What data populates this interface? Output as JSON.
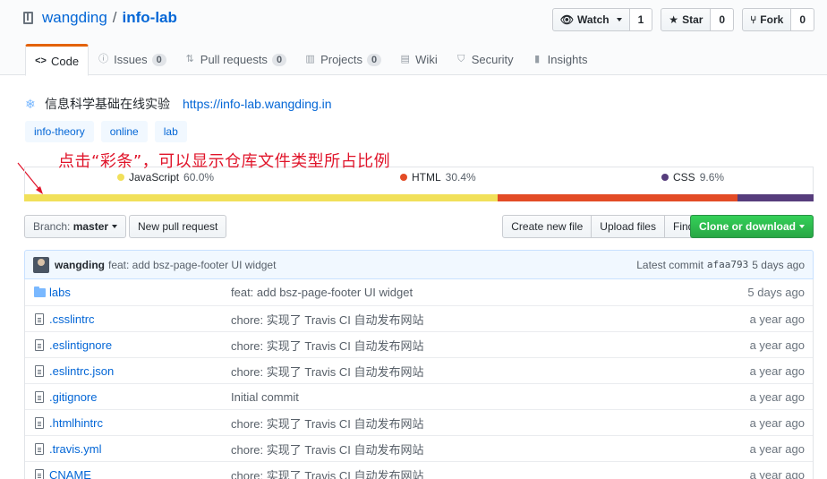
{
  "repo": {
    "owner": "wangding",
    "separator": "/",
    "name": "info-lab"
  },
  "actions": [
    {
      "label": "Watch",
      "icon": "eye-icon",
      "count": "1"
    },
    {
      "label": "Star",
      "icon": "star-icon",
      "count": "0"
    },
    {
      "label": "Fork",
      "icon": "fork-icon",
      "count": "0"
    }
  ],
  "tabs": [
    {
      "label": "Code",
      "icon": "code-icon",
      "selected": true
    },
    {
      "label": "Issues",
      "icon": "issue-icon",
      "count": "0"
    },
    {
      "label": "Pull requests",
      "icon": "pull-request-icon",
      "count": "0"
    },
    {
      "label": "Projects",
      "icon": "project-icon",
      "count": "0"
    },
    {
      "label": "Wiki",
      "icon": "book-icon"
    },
    {
      "label": "Security",
      "icon": "shield-icon"
    },
    {
      "label": "Insights",
      "icon": "graph-icon"
    }
  ],
  "description": {
    "text": "信息科学基础在线实验",
    "url": "https://info-lab.wangding.in"
  },
  "topics": [
    "info-theory",
    "online",
    "lab"
  ],
  "annotation": "点击“彩条”，可以显示仓库文件类型所占比例",
  "languages": [
    {
      "name": "JavaScript",
      "percent": "60.0%",
      "value": 60.0,
      "color": "#f1e05a"
    },
    {
      "name": "HTML",
      "percent": "30.4%",
      "value": 30.4,
      "color": "#e34c26"
    },
    {
      "name": "CSS",
      "percent": "9.6%",
      "value": 9.6,
      "color": "#563d7c"
    }
  ],
  "nav": {
    "branch_label": "Branch:",
    "branch": "master",
    "new_pr": "New pull request",
    "create_file": "Create new file",
    "upload": "Upload files",
    "find": "Find File",
    "clone": "Clone or download"
  },
  "latest_commit": {
    "author": "wangding",
    "message": "feat: add bsz-page-footer UI widget",
    "label": "Latest commit",
    "sha": "afaa793",
    "age": "5 days ago"
  },
  "files": [
    {
      "type": "dir",
      "name": "labs",
      "message": "feat: add bsz-page-footer UI widget",
      "age": "5 days ago"
    },
    {
      "type": "file",
      "name": ".csslintrc",
      "message": "chore: 实现了 Travis CI 自动发布网站",
      "age": "a year ago"
    },
    {
      "type": "file",
      "name": ".eslintignore",
      "message": "chore: 实现了 Travis CI 自动发布网站",
      "age": "a year ago"
    },
    {
      "type": "file",
      "name": ".eslintrc.json",
      "message": "chore: 实现了 Travis CI 自动发布网站",
      "age": "a year ago"
    },
    {
      "type": "file",
      "name": ".gitignore",
      "message": "Initial commit",
      "age": "a year ago"
    },
    {
      "type": "file",
      "name": ".htmlhintrc",
      "message": "chore: 实现了 Travis CI 自动发布网站",
      "age": "a year ago"
    },
    {
      "type": "file",
      "name": ".travis.yml",
      "message": "chore: 实现了 Travis CI 自动发布网站",
      "age": "a year ago"
    },
    {
      "type": "file",
      "name": "CNAME",
      "message": "chore: 实现了 Travis CI 自动发布网站",
      "age": "a year ago"
    }
  ]
}
